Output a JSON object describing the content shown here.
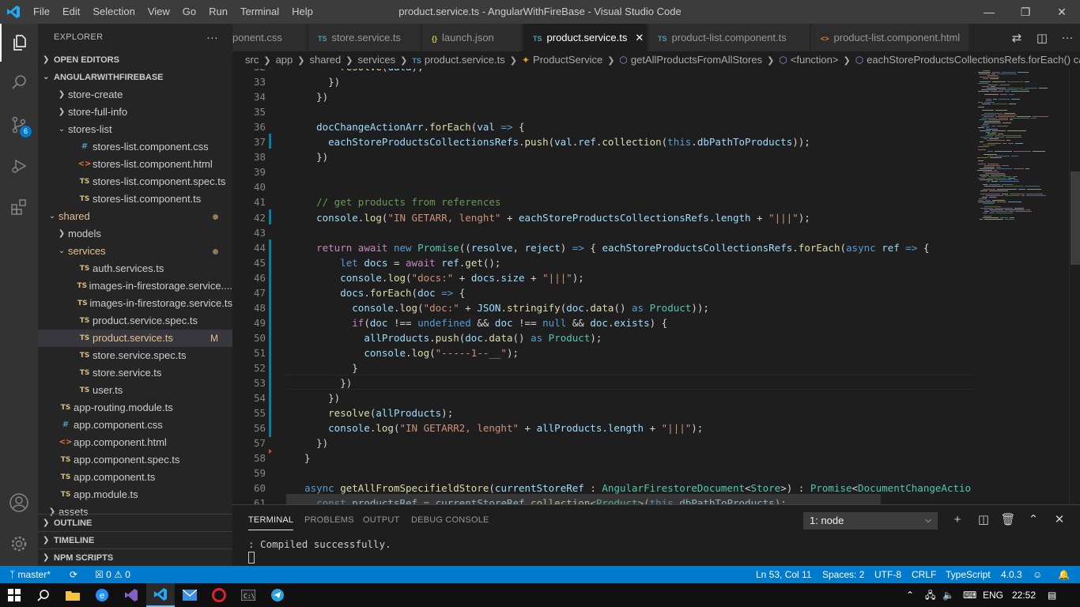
{
  "titlebar": {
    "menu": [
      "File",
      "Edit",
      "Selection",
      "View",
      "Go",
      "Run",
      "Terminal",
      "Help"
    ],
    "title": "product.service.ts - AngularWithFireBase - Visual Studio Code"
  },
  "activity": {
    "scm_badge": "6"
  },
  "sidebar": {
    "title": "EXPLORER",
    "open_editors": "OPEN EDITORS",
    "project": "ANGULARWITHFIREBASE",
    "tree": [
      {
        "label": "store-create",
        "kind": "folder-closed",
        "indent": 2
      },
      {
        "label": "store-full-info",
        "kind": "folder-closed",
        "indent": 2
      },
      {
        "label": "stores-list",
        "kind": "folder-open",
        "indent": 2
      },
      {
        "label": "stores-list.component.css",
        "kind": "css",
        "indent": 3
      },
      {
        "label": "stores-list.component.html",
        "kind": "html",
        "indent": 3
      },
      {
        "label": "stores-list.component.spec.ts",
        "kind": "ts",
        "indent": 3
      },
      {
        "label": "stores-list.component.ts",
        "kind": "ts",
        "indent": 3
      },
      {
        "label": "shared",
        "kind": "folder-open",
        "indent": 1,
        "dot": true,
        "modified": true
      },
      {
        "label": "models",
        "kind": "folder-closed",
        "indent": 2
      },
      {
        "label": "services",
        "kind": "folder-open",
        "indent": 2,
        "dot": true,
        "modified": true
      },
      {
        "label": "auth.services.ts",
        "kind": "ts",
        "indent": 3
      },
      {
        "label": "images-in-firestorage.service....",
        "kind": "ts",
        "indent": 3
      },
      {
        "label": "images-in-firestorage.service.ts",
        "kind": "ts",
        "indent": 3
      },
      {
        "label": "product.service.spec.ts",
        "kind": "ts",
        "indent": 3
      },
      {
        "label": "product.service.ts",
        "kind": "ts",
        "indent": 3,
        "selected": true,
        "modified": true,
        "mark": "M"
      },
      {
        "label": "store.service.spec.ts",
        "kind": "ts",
        "indent": 3
      },
      {
        "label": "store.service.ts",
        "kind": "ts",
        "indent": 3
      },
      {
        "label": "user.ts",
        "kind": "ts",
        "indent": 3
      },
      {
        "label": "app-routing.module.ts",
        "kind": "ts",
        "indent": 1
      },
      {
        "label": "app.component.css",
        "kind": "css",
        "indent": 1
      },
      {
        "label": "app.component.html",
        "kind": "html",
        "indent": 1
      },
      {
        "label": "app.component.spec.ts",
        "kind": "ts",
        "indent": 1
      },
      {
        "label": "app.component.ts",
        "kind": "ts",
        "indent": 1
      },
      {
        "label": "app.module.ts",
        "kind": "ts",
        "indent": 1
      },
      {
        "label": "assets",
        "kind": "folder-closed",
        "indent": 1
      }
    ],
    "outline": "OUTLINE",
    "timeline": "TIMELINE",
    "npm": "NPM SCRIPTS"
  },
  "tabs": [
    {
      "label": "ponent.css",
      "icon": "#",
      "kind": "css"
    },
    {
      "label": "store.service.ts",
      "icon": "TS",
      "kind": "ts"
    },
    {
      "label": "launch.json",
      "icon": "{}",
      "kind": "json"
    },
    {
      "label": "product.service.ts",
      "icon": "TS",
      "kind": "ts",
      "active": true
    },
    {
      "label": "product-list.component.ts",
      "icon": "TS",
      "kind": "ts"
    },
    {
      "label": "product-list.component.html",
      "icon": "<>",
      "kind": "html"
    }
  ],
  "breadcrumb": [
    "src",
    "app",
    "shared",
    "services",
    "product.service.ts",
    "ProductService",
    "getAllProductsFromAllStores",
    "<function>",
    "eachStoreProductsCollectionsRefs.forEach() callba"
  ],
  "code": [
    {
      "n": "32",
      "t": [
        [
          "pn",
          "        "
        ],
        [
          "fn",
          "resolve"
        ],
        [
          "pn",
          "("
        ],
        [
          "vr",
          "data"
        ],
        [
          "pn",
          ");"
        ]
      ]
    },
    {
      "n": "33",
      "t": [
        [
          "pn",
          "      })"
        ]
      ]
    },
    {
      "n": "34",
      "t": [
        [
          "pn",
          "    })"
        ]
      ]
    },
    {
      "n": "35",
      "t": []
    },
    {
      "n": "36",
      "t": [
        [
          "pn",
          "    "
        ],
        [
          "vr",
          "docChangeActionArr"
        ],
        [
          "pn",
          "."
        ],
        [
          "fn",
          "forEach"
        ],
        [
          "pn",
          "("
        ],
        [
          "vr",
          "val"
        ],
        [
          "pn",
          " "
        ],
        [
          "k1",
          "=>"
        ],
        [
          "pn",
          " {"
        ]
      ]
    },
    {
      "n": "37",
      "t": [
        [
          "pn",
          "      "
        ],
        [
          "vr",
          "eachStoreProductsCollectionsRefs"
        ],
        [
          "pn",
          "."
        ],
        [
          "fn",
          "push"
        ],
        [
          "pn",
          "("
        ],
        [
          "vr",
          "val"
        ],
        [
          "pn",
          "."
        ],
        [
          "vr",
          "ref"
        ],
        [
          "pn",
          "."
        ],
        [
          "fn",
          "collection"
        ],
        [
          "pn",
          "("
        ],
        [
          "k1",
          "this"
        ],
        [
          "pn",
          "."
        ],
        [
          "vr",
          "dbPathToProducts"
        ],
        [
          "pn",
          "));"
        ]
      ]
    },
    {
      "n": "38",
      "t": [
        [
          "pn",
          "    })"
        ]
      ]
    },
    {
      "n": "39",
      "t": []
    },
    {
      "n": "40",
      "t": []
    },
    {
      "n": "41",
      "t": [
        [
          "pn",
          "    "
        ],
        [
          "cm",
          "// get products from references"
        ]
      ]
    },
    {
      "n": "42",
      "t": [
        [
          "pn",
          "    "
        ],
        [
          "vr",
          "console"
        ],
        [
          "pn",
          "."
        ],
        [
          "fn",
          "log"
        ],
        [
          "pn",
          "("
        ],
        [
          "st",
          "\"IN GETARR, lenght\""
        ],
        [
          "pn",
          " + "
        ],
        [
          "vr",
          "eachStoreProductsCollectionsRefs"
        ],
        [
          "pn",
          "."
        ],
        [
          "vr",
          "length"
        ],
        [
          "pn",
          " + "
        ],
        [
          "st",
          "\"|||\""
        ],
        [
          "pn",
          ");"
        ]
      ]
    },
    {
      "n": "43",
      "t": []
    },
    {
      "n": "44",
      "t": [
        [
          "pn",
          "    "
        ],
        [
          "k2",
          "return"
        ],
        [
          "pn",
          " "
        ],
        [
          "k2",
          "await"
        ],
        [
          "pn",
          " "
        ],
        [
          "k1",
          "new"
        ],
        [
          "pn",
          " "
        ],
        [
          "ty",
          "Promise"
        ],
        [
          "pn",
          "(("
        ],
        [
          "vr",
          "resolve"
        ],
        [
          "pn",
          ", "
        ],
        [
          "vr",
          "reject"
        ],
        [
          "pn",
          ") "
        ],
        [
          "k1",
          "=>"
        ],
        [
          "pn",
          " { "
        ],
        [
          "vr",
          "eachStoreProductsCollectionsRefs"
        ],
        [
          "pn",
          "."
        ],
        [
          "fn",
          "forEach"
        ],
        [
          "pn",
          "("
        ],
        [
          "k1",
          "async"
        ],
        [
          "pn",
          " "
        ],
        [
          "vr",
          "ref"
        ],
        [
          "pn",
          " "
        ],
        [
          "k1",
          "=>"
        ],
        [
          "pn",
          " {"
        ]
      ]
    },
    {
      "n": "45",
      "t": [
        [
          "pn",
          "        "
        ],
        [
          "k1",
          "let"
        ],
        [
          "pn",
          " "
        ],
        [
          "vr",
          "docs"
        ],
        [
          "pn",
          " = "
        ],
        [
          "k2",
          "await"
        ],
        [
          "pn",
          " "
        ],
        [
          "vr",
          "ref"
        ],
        [
          "pn",
          "."
        ],
        [
          "fn",
          "get"
        ],
        [
          "pn",
          "();"
        ]
      ]
    },
    {
      "n": "46",
      "t": [
        [
          "pn",
          "        "
        ],
        [
          "vr",
          "console"
        ],
        [
          "pn",
          "."
        ],
        [
          "fn",
          "log"
        ],
        [
          "pn",
          "("
        ],
        [
          "st",
          "\"docs:\""
        ],
        [
          "pn",
          " + "
        ],
        [
          "vr",
          "docs"
        ],
        [
          "pn",
          "."
        ],
        [
          "vr",
          "size"
        ],
        [
          "pn",
          " + "
        ],
        [
          "st",
          "\"|||\""
        ],
        [
          "pn",
          ");"
        ]
      ]
    },
    {
      "n": "47",
      "t": [
        [
          "pn",
          "        "
        ],
        [
          "vr",
          "docs"
        ],
        [
          "pn",
          "."
        ],
        [
          "fn",
          "forEach"
        ],
        [
          "pn",
          "("
        ],
        [
          "vr",
          "doc"
        ],
        [
          "pn",
          " "
        ],
        [
          "k1",
          "=>"
        ],
        [
          "pn",
          " {"
        ]
      ]
    },
    {
      "n": "48",
      "t": [
        [
          "pn",
          "          "
        ],
        [
          "vr",
          "console"
        ],
        [
          "pn",
          "."
        ],
        [
          "fn",
          "log"
        ],
        [
          "pn",
          "("
        ],
        [
          "st",
          "\"doc:\""
        ],
        [
          "pn",
          " + "
        ],
        [
          "vr",
          "JSON"
        ],
        [
          "pn",
          "."
        ],
        [
          "fn",
          "stringify"
        ],
        [
          "pn",
          "("
        ],
        [
          "vr",
          "doc"
        ],
        [
          "pn",
          "."
        ],
        [
          "fn",
          "data"
        ],
        [
          "pn",
          "() "
        ],
        [
          "k1",
          "as"
        ],
        [
          "pn",
          " "
        ],
        [
          "ty",
          "Product"
        ],
        [
          "pn",
          "));"
        ]
      ]
    },
    {
      "n": "49",
      "t": [
        [
          "pn",
          "          "
        ],
        [
          "k2",
          "if"
        ],
        [
          "pn",
          "("
        ],
        [
          "vr",
          "doc"
        ],
        [
          "pn",
          " !== "
        ],
        [
          "k1",
          "undefined"
        ],
        [
          "pn",
          " && "
        ],
        [
          "vr",
          "doc"
        ],
        [
          "pn",
          " !== "
        ],
        [
          "k1",
          "null"
        ],
        [
          "pn",
          " && "
        ],
        [
          "vr",
          "doc"
        ],
        [
          "pn",
          "."
        ],
        [
          "vr",
          "exists"
        ],
        [
          "pn",
          ") {"
        ]
      ]
    },
    {
      "n": "50",
      "t": [
        [
          "pn",
          "            "
        ],
        [
          "vr",
          "allProducts"
        ],
        [
          "pn",
          "."
        ],
        [
          "fn",
          "push"
        ],
        [
          "pn",
          "("
        ],
        [
          "vr",
          "doc"
        ],
        [
          "pn",
          "."
        ],
        [
          "fn",
          "data"
        ],
        [
          "pn",
          "() "
        ],
        [
          "k1",
          "as"
        ],
        [
          "pn",
          " "
        ],
        [
          "ty",
          "Product"
        ],
        [
          "pn",
          ");"
        ]
      ]
    },
    {
      "n": "51",
      "t": [
        [
          "pn",
          "            "
        ],
        [
          "vr",
          "console"
        ],
        [
          "pn",
          "."
        ],
        [
          "fn",
          "log"
        ],
        [
          "pn",
          "("
        ],
        [
          "st",
          "\"-----1--__\""
        ],
        [
          "pn",
          ");"
        ]
      ]
    },
    {
      "n": "52",
      "t": [
        [
          "pn",
          "          }"
        ]
      ]
    },
    {
      "n": "53",
      "t": [
        [
          "pn",
          "        })"
        ]
      ]
    },
    {
      "n": "54",
      "t": [
        [
          "pn",
          "      })"
        ]
      ]
    },
    {
      "n": "55",
      "t": [
        [
          "pn",
          "      "
        ],
        [
          "fn",
          "resolve"
        ],
        [
          "pn",
          "("
        ],
        [
          "vr",
          "allProducts"
        ],
        [
          "pn",
          ");"
        ]
      ]
    },
    {
      "n": "56",
      "t": [
        [
          "pn",
          "      "
        ],
        [
          "vr",
          "console"
        ],
        [
          "pn",
          "."
        ],
        [
          "fn",
          "log"
        ],
        [
          "pn",
          "("
        ],
        [
          "st",
          "\"IN GETARR2, lenght\""
        ],
        [
          "pn",
          " + "
        ],
        [
          "vr",
          "allProducts"
        ],
        [
          "pn",
          "."
        ],
        [
          "vr",
          "length"
        ],
        [
          "pn",
          " + "
        ],
        [
          "st",
          "\"|||\""
        ],
        [
          "pn",
          ");"
        ]
      ]
    },
    {
      "n": "57",
      "t": [
        [
          "pn",
          "    })"
        ]
      ]
    },
    {
      "n": "58",
      "t": [
        [
          "pn",
          "  }"
        ]
      ]
    },
    {
      "n": "59",
      "t": []
    },
    {
      "n": "60",
      "t": [
        [
          "pn",
          "  "
        ],
        [
          "k1",
          "async"
        ],
        [
          "pn",
          " "
        ],
        [
          "fn",
          "getAllFromSpecifieldStore"
        ],
        [
          "pn",
          "("
        ],
        [
          "vr",
          "currentStoreRef"
        ],
        [
          "pn",
          " : "
        ],
        [
          "ty",
          "AngularFirestoreDocument"
        ],
        [
          "pn",
          "<"
        ],
        [
          "ty",
          "Store"
        ],
        [
          "pn",
          ">) : "
        ],
        [
          "ty",
          "Promise"
        ],
        [
          "pn",
          "<"
        ],
        [
          "ty",
          "DocumentChangeActio"
        ]
      ]
    },
    {
      "n": "61",
      "t": [
        [
          "pn",
          "    "
        ],
        [
          "k1",
          "const"
        ],
        [
          "pn",
          " "
        ],
        [
          "vr",
          "productsRef"
        ],
        [
          "pn",
          " = "
        ],
        [
          "vr",
          "currentStoreRef"
        ],
        [
          "pn",
          "."
        ],
        [
          "fn",
          "collection"
        ],
        [
          "pn",
          "<"
        ],
        [
          "ty",
          "Product"
        ],
        [
          "pn",
          ">("
        ],
        [
          "k1",
          "this"
        ],
        [
          "pn",
          "."
        ],
        [
          "vr",
          "dbPathToProducts"
        ],
        [
          "pn",
          ");"
        ]
      ]
    }
  ],
  "panel": {
    "tabs": [
      "TERMINAL",
      "PROBLEMS",
      "OUTPUT",
      "DEBUG CONSOLE"
    ],
    "terminal_select": "1: node",
    "output": ": Compiled successfully."
  },
  "statusbar": {
    "branch": "master*",
    "errors": "0",
    "warnings": "0",
    "position": "Ln 53, Col 11",
    "spaces": "Spaces: 2",
    "encoding": "UTF-8",
    "eol": "CRLF",
    "language": "TypeScript",
    "version": "4.0.3"
  },
  "taskbar": {
    "lang": "ENG",
    "time": "22:52"
  }
}
